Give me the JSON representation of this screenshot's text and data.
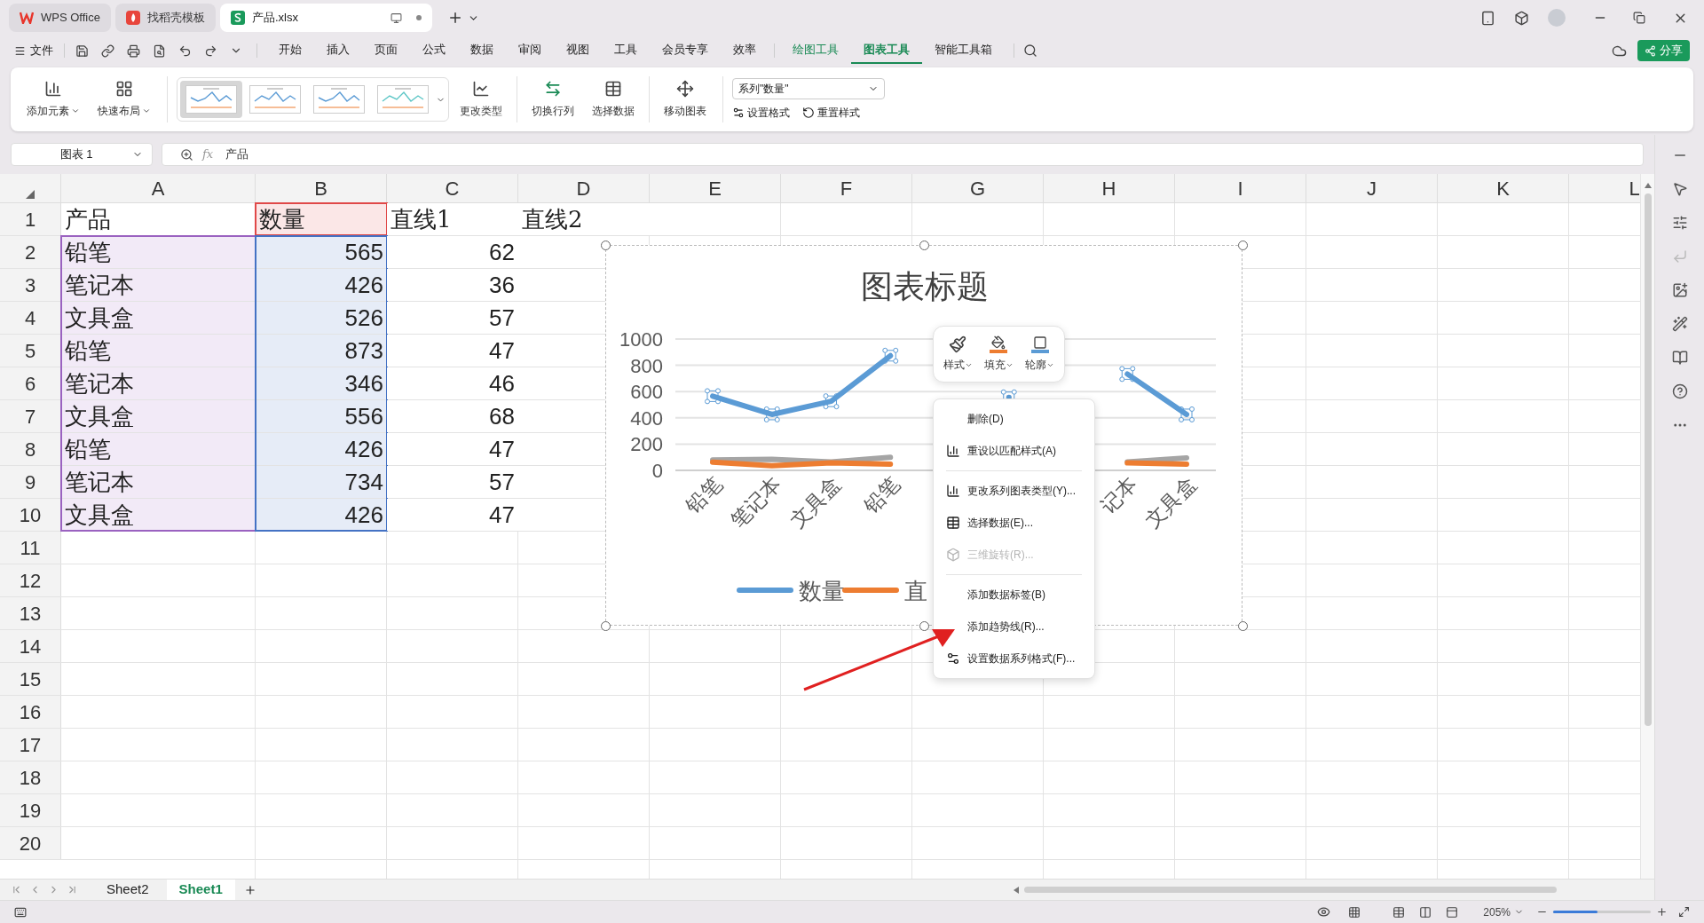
{
  "title_tabs": [
    {
      "label": "WPS Office",
      "selected": false,
      "kind": "app"
    },
    {
      "label": "找稻壳模板",
      "selected": false,
      "kind": "template"
    },
    {
      "label": "产品.xlsx",
      "selected": true,
      "kind": "sheet"
    }
  ],
  "menu": {
    "file": "文件",
    "tabs": [
      {
        "label": "开始",
        "selected": false,
        "kind": "main"
      },
      {
        "label": "插入",
        "selected": false,
        "kind": "main"
      },
      {
        "label": "页面",
        "selected": false,
        "kind": "main"
      },
      {
        "label": "公式",
        "selected": false,
        "kind": "main"
      },
      {
        "label": "数据",
        "selected": false,
        "kind": "main"
      },
      {
        "label": "审阅",
        "selected": false,
        "kind": "main"
      },
      {
        "label": "视图",
        "selected": false,
        "kind": "main"
      },
      {
        "label": "工具",
        "selected": false,
        "kind": "main"
      },
      {
        "label": "会员专享",
        "selected": false,
        "kind": "main"
      },
      {
        "label": "效率",
        "selected": false,
        "kind": "main"
      },
      {
        "label": "绘图工具",
        "selected": false,
        "kind": "context"
      },
      {
        "label": "图表工具",
        "selected": true,
        "kind": "context"
      },
      {
        "label": "智能工具箱",
        "selected": false,
        "kind": "main"
      }
    ]
  },
  "share_button": "分享",
  "ribbon": {
    "left": [
      {
        "label": "添加元素",
        "dropdown": true
      },
      {
        "label": "快速布局",
        "dropdown": true
      }
    ],
    "styles": [
      {
        "selected": true
      },
      {
        "selected": false
      },
      {
        "selected": false
      },
      {
        "selected": false
      }
    ],
    "buttons": [
      "更改类型",
      "切换行列",
      "选择数据",
      "移动图表"
    ],
    "series_select": "系列\"数量\"",
    "format_buttons": [
      "设置格式",
      "重置样式"
    ]
  },
  "formula_bar": {
    "name_box": "图表 1",
    "fx": "fx",
    "content": "产品"
  },
  "sheet": {
    "columns": [
      "A",
      "B",
      "C",
      "D",
      "E",
      "F",
      "G",
      "H",
      "I",
      "J",
      "K",
      "L"
    ],
    "rows": [
      {
        "number": "1",
        "cells": [
          {
            "text": "产品",
            "kind": "text"
          },
          {
            "text": "数量",
            "kind": "text",
            "color": "#e04848"
          },
          {
            "text": "直线1",
            "kind": "text"
          },
          {
            "text": "直线2",
            "kind": "text"
          }
        ]
      },
      {
        "number": "2",
        "cells": [
          {
            "text": "铅笔",
            "kind": "text",
            "color": "#9a62c0"
          },
          {
            "text": "565",
            "kind": "number",
            "color": "#4472c4"
          },
          {
            "text": "62",
            "kind": "number"
          }
        ]
      },
      {
        "number": "3",
        "cells": [
          {
            "text": "笔记本",
            "kind": "text",
            "color": "#9a62c0"
          },
          {
            "text": "426",
            "kind": "number",
            "color": "#4472c4"
          },
          {
            "text": "36",
            "kind": "number"
          }
        ]
      },
      {
        "number": "4",
        "cells": [
          {
            "text": "文具盒",
            "kind": "text",
            "color": "#9a62c0"
          },
          {
            "text": "526",
            "kind": "number",
            "color": "#4472c4"
          },
          {
            "text": "57",
            "kind": "number"
          }
        ]
      },
      {
        "number": "5",
        "cells": [
          {
            "text": "铅笔",
            "kind": "text",
            "color": "#9a62c0"
          },
          {
            "text": "873",
            "kind": "number",
            "color": "#4472c4"
          },
          {
            "text": "47",
            "kind": "number"
          }
        ]
      },
      {
        "number": "6",
        "cells": [
          {
            "text": "笔记本",
            "kind": "text",
            "color": "#9a62c0"
          },
          {
            "text": "346",
            "kind": "number",
            "color": "#4472c4"
          },
          {
            "text": "46",
            "kind": "number"
          }
        ]
      },
      {
        "number": "7",
        "cells": [
          {
            "text": "文具盒",
            "kind": "text",
            "color": "#9a62c0"
          },
          {
            "text": "556",
            "kind": "number",
            "color": "#4472c4"
          },
          {
            "text": "68",
            "kind": "number"
          }
        ]
      },
      {
        "number": "8",
        "cells": [
          {
            "text": "铅笔",
            "kind": "text",
            "color": "#9a62c0"
          },
          {
            "text": "426",
            "kind": "number",
            "color": "#4472c4"
          },
          {
            "text": "47",
            "kind": "number"
          }
        ]
      },
      {
        "number": "9",
        "cells": [
          {
            "text": "笔记本",
            "kind": "text",
            "color": "#9a62c0"
          },
          {
            "text": "734",
            "kind": "number",
            "color": "#4472c4"
          },
          {
            "text": "57",
            "kind": "number"
          }
        ]
      },
      {
        "number": "10",
        "cells": [
          {
            "text": "文具盒",
            "kind": "text",
            "color": "#9a62c0"
          },
          {
            "text": "426",
            "kind": "number",
            "color": "#4472c4"
          },
          {
            "text": "47",
            "kind": "number"
          }
        ]
      },
      {
        "number": "11"
      },
      {
        "number": "12"
      },
      {
        "number": "13"
      },
      {
        "number": "14"
      },
      {
        "number": "15"
      },
      {
        "number": "16"
      },
      {
        "number": "17"
      },
      {
        "number": "18"
      },
      {
        "number": "19"
      },
      {
        "number": "20"
      }
    ]
  },
  "chart": {
    "chart_data": {
      "type": "line",
      "title": "图表标题",
      "categories": [
        "铅笔",
        "笔记本",
        "文具盒",
        "铅笔",
        null,
        null,
        null,
        "记本",
        "文具盒"
      ],
      "series": [
        {
          "name": "数量",
          "color": "#5b9bd5",
          "marker": "square",
          "values": [
            565,
            426,
            526,
            873,
            null,
            556,
            null,
            734,
            426
          ]
        },
        {
          "name": "直",
          "color": "#ed7d31",
          "values": [
            62,
            36,
            57,
            47,
            null,
            null,
            null,
            57,
            47
          ]
        },
        {
          "color": "#a5a5a5",
          "values": [
            80,
            85,
            65,
            100,
            null,
            null,
            null,
            65,
            95
          ]
        }
      ],
      "ylim": [
        0,
        1000
      ],
      "yticks": [
        0,
        200,
        400,
        600,
        800,
        1000
      ],
      "grid": true,
      "legend": true
    }
  },
  "format_toolbar": [
    {
      "label": "样式"
    },
    {
      "label": "填充"
    },
    {
      "label": "轮廓"
    }
  ],
  "context_menu": [
    {
      "kind": "item",
      "label": "删除(D)",
      "disabled": false
    },
    {
      "kind": "item",
      "label": "重设以匹配样式(A)",
      "disabled": false
    },
    {
      "kind": "separator"
    },
    {
      "kind": "item",
      "label": "更改系列图表类型(Y)...",
      "disabled": false
    },
    {
      "kind": "item",
      "label": "选择数据(E)...",
      "disabled": false
    },
    {
      "kind": "item",
      "label": "三维旋转(R)...",
      "disabled": true
    },
    {
      "kind": "separator"
    },
    {
      "kind": "item",
      "label": "添加数据标签(B)",
      "disabled": false
    },
    {
      "kind": "item",
      "label": "添加趋势线(R)...",
      "disabled": false
    },
    {
      "kind": "item",
      "label": "设置数据系列格式(F)...",
      "disabled": false
    }
  ],
  "sheet_tabs": [
    {
      "label": "Sheet2",
      "selected": false
    },
    {
      "label": "Sheet1",
      "selected": true
    }
  ],
  "status_bar": {
    "zoom": "205%",
    "zoom_slider": {
      "level": 0.45
    }
  }
}
